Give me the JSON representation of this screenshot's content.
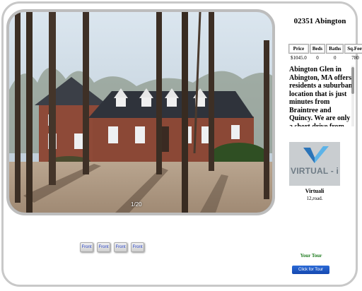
{
  "listing": {
    "address": "02351 Abington",
    "photo_counter": "1/20",
    "table": {
      "headers": [
        "Price",
        "Beds",
        "Baths",
        "Sq.Feet"
      ],
      "values": [
        "$1045.0",
        "0",
        "0",
        "780"
      ]
    },
    "description": "Abington Glen in Abington, MA offers residents a suburban location that is just minutes from Braintree and Quincy. We are only a short drive from"
  },
  "brand": {
    "logo_text": "VIRTUAL - i",
    "name": "Virtuali",
    "address": "12,road."
  },
  "thumbnails": [
    "Front",
    "Front",
    "Front",
    "Front"
  ],
  "tour": {
    "label": "Your Tour",
    "button": "Click for Tour"
  },
  "colors": {
    "tour_label": "#1d7a1d",
    "tour_button": "#1f5cc8",
    "thumb_text": "#2a45c8",
    "frame_border": "#c8c8c8"
  },
  "icons": {
    "logo_mark": "v-checkmark-icon"
  }
}
